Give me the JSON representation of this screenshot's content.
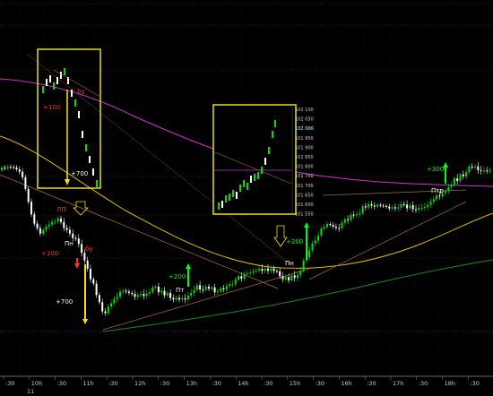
{
  "chart_data": {
    "type": "candlestick",
    "time_axis": {
      "labels": [
        ":30",
        "10h",
        ":30",
        "11h",
        ":30",
        "12h",
        ":30",
        "13h",
        ":30",
        "14h",
        ":30",
        "15h",
        ":30",
        "16h",
        ":30",
        "17h",
        ":30",
        "18h",
        ":30"
      ],
      "date_label": "11"
    },
    "inset_price_axis": {
      "labels": [
        "102 100",
        "102 050",
        "102 000",
        "101 950",
        "101 900",
        "101 850",
        "101 800",
        "101 750",
        "101 700",
        "101 650",
        "101 600",
        "101 550"
      ],
      "current_price_label": "102 000"
    },
    "annotations": [
      {
        "id": "up",
        "text": "by",
        "color": "#ff3030"
      },
      {
        "id": "plus100_a",
        "text": "+100",
        "color": "#ff3030"
      },
      {
        "id": "plus700_a",
        "text": "+700",
        "color": "#ffffff"
      },
      {
        "id": "lp",
        "text": "ЛП",
        "color": "#ff3030"
      },
      {
        "id": "pn_a",
        "text": "Пн",
        "color": "#ffffff"
      },
      {
        "id": "plus100_b",
        "text": "+100",
        "color": "#ff3030"
      },
      {
        "id": "by_b",
        "text": "бу",
        "color": "#ff3030"
      },
      {
        "id": "plus700_b",
        "text": "+700",
        "color": "#ffffff"
      },
      {
        "id": "plus200_a",
        "text": "+200",
        "color": "#00ff00"
      },
      {
        "id": "pt",
        "text": "Пт",
        "color": "#ffffff"
      },
      {
        "id": "plus200_b",
        "text": "+200",
        "color": "#00ff00"
      },
      {
        "id": "pn_b",
        "text": "Пн",
        "color": "#ffffff"
      },
      {
        "id": "plus300",
        "text": "+300",
        "color": "#00ff00"
      },
      {
        "id": "ptr",
        "text": "Птр",
        "color": "#ffffff"
      }
    ],
    "colors": {
      "background": "#000000",
      "bull_candle": "#00e000",
      "bear_candle": "#ffffff",
      "ma_magenta": "#cc33cc",
      "ma_yellow": "#d8c000",
      "ma_green": "#1f8a1f",
      "trend_line": "#a07040",
      "box_border": "#e8e000"
    }
  }
}
